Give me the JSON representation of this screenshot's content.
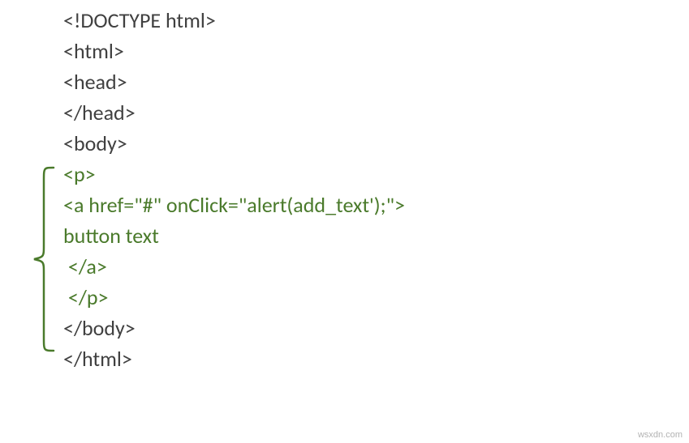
{
  "code": {
    "lines": [
      "<!DOCTYPE html>",
      "<html>",
      "<head>",
      "</head>",
      "<body>",
      "<p>",
      "<a href=\"#\" onClick=\"alert(add_text');\">",
      "button text",
      " </a>",
      " </p>",
      "</body>",
      "</html>"
    ]
  },
  "watermark": "wsxdn.com"
}
